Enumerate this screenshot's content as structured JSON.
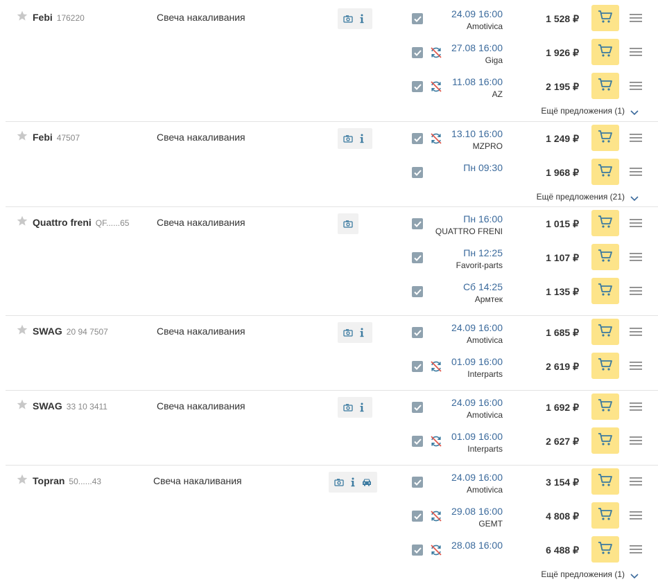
{
  "currency": "₽",
  "more_label": "Ещё предложения",
  "products": [
    {
      "brand": "Febi",
      "article": "176220",
      "name": "Свеча накаливания",
      "icons": [
        "photo-icon",
        "info-icon"
      ],
      "offers": [
        {
          "date": "24.09 16:00",
          "supplier": "Amotivica",
          "price": "1 528 ₽",
          "noreturn": false
        },
        {
          "date": "27.08 16:00",
          "supplier": "Giga",
          "price": "1 926 ₽",
          "noreturn": true
        },
        {
          "date": "11.08 16:00",
          "supplier": "AZ",
          "price": "2 195 ₽",
          "noreturn": true
        }
      ],
      "more": "Ещё предложения (1)"
    },
    {
      "brand": "Febi",
      "article": "47507",
      "name": "Свеча накаливания",
      "icons": [
        "photo-icon",
        "info-icon"
      ],
      "offers": [
        {
          "date": "13.10 16:00",
          "supplier": "MZPRO",
          "price": "1 249 ₽",
          "noreturn": true
        },
        {
          "date": "Пн 09:30",
          "supplier": "",
          "price": "1 968 ₽",
          "noreturn": false
        }
      ],
      "more": "Ещё предложения (21)"
    },
    {
      "brand": "Quattro freni",
      "article": "QF......65",
      "name": "Свеча накаливания",
      "icons": [
        "photo-icon"
      ],
      "offers": [
        {
          "date": "Пн 16:00",
          "supplier": "QUATTRO FRENI",
          "price": "1 015 ₽",
          "noreturn": false
        },
        {
          "date": "Пн 12:25",
          "supplier": "Favorit-parts",
          "price": "1 107 ₽",
          "noreturn": false
        },
        {
          "date": "Сб 14:25",
          "supplier": "Армтек",
          "price": "1 135 ₽",
          "noreturn": false
        }
      ],
      "more": ""
    },
    {
      "brand": "SWAG",
      "article": "20 94 7507",
      "name": "Свеча накаливания",
      "icons": [
        "photo-icon",
        "info-icon"
      ],
      "offers": [
        {
          "date": "24.09 16:00",
          "supplier": "Amotivica",
          "price": "1 685 ₽",
          "noreturn": false
        },
        {
          "date": "01.09 16:00",
          "supplier": "Interparts",
          "price": "2 619 ₽",
          "noreturn": true
        }
      ],
      "more": ""
    },
    {
      "brand": "SWAG",
      "article": "33 10 3411",
      "name": "Свеча накаливания",
      "icons": [
        "photo-icon",
        "info-icon"
      ],
      "offers": [
        {
          "date": "24.09 16:00",
          "supplier": "Amotivica",
          "price": "1 692 ₽",
          "noreturn": false
        },
        {
          "date": "01.09 16:00",
          "supplier": "Interparts",
          "price": "2 627 ₽",
          "noreturn": true
        }
      ],
      "more": ""
    },
    {
      "brand": "Topran",
      "article": "50......43",
      "name": "Свеча накаливания",
      "icons": [
        "photo-icon",
        "info-icon",
        "car-icon"
      ],
      "offers": [
        {
          "date": "24.09 16:00",
          "supplier": "Amotivica",
          "price": "3 154 ₽",
          "noreturn": false
        },
        {
          "date": "29.08 16:00",
          "supplier": "GEMT",
          "price": "4 808 ₽",
          "noreturn": true
        },
        {
          "date": "28.08 16:00",
          "supplier": "",
          "price": "6 488 ₽",
          "noreturn": true
        }
      ],
      "more": "Ещё предложения (1)"
    }
  ]
}
